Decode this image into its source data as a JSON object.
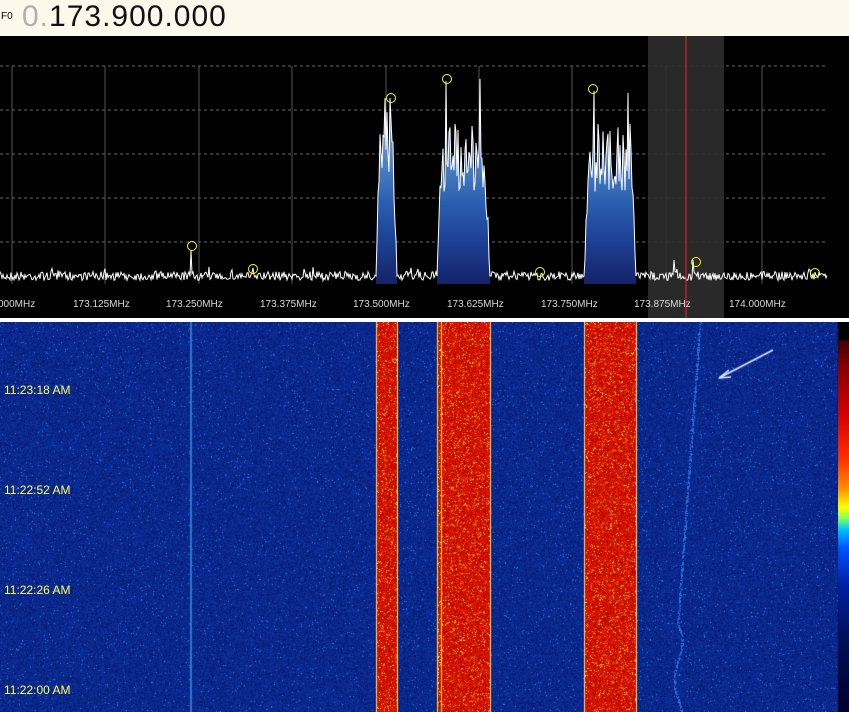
{
  "vfo": {
    "label": "F0",
    "prefix": "0.",
    "frequency": "173.900.000"
  },
  "spectrum": {
    "axis_labels": [
      "000MHz",
      "173.125MHz",
      "173.250MHz",
      "173.375MHz",
      "173.500MHz",
      "173.625MHz",
      "173.750MHz",
      "173.875MHz",
      "174.000MHz"
    ]
  },
  "waterfall": {
    "timestamps": [
      "11:23:18 AM",
      "11:22:52 AM",
      "11:22:26 AM",
      "11:22:00 AM"
    ]
  },
  "colors": {
    "background": "#000000",
    "spectrum_trace": "#ffffff",
    "spectrum_fill_top": "#9ab8d8",
    "spectrum_fill_bottom": "#1a2a70",
    "tuner_line": "#ff2020",
    "peak_marker": "#ffff00",
    "waterfall_bg": "#0a1a6e",
    "timestamp_text": "#ffff60"
  }
}
